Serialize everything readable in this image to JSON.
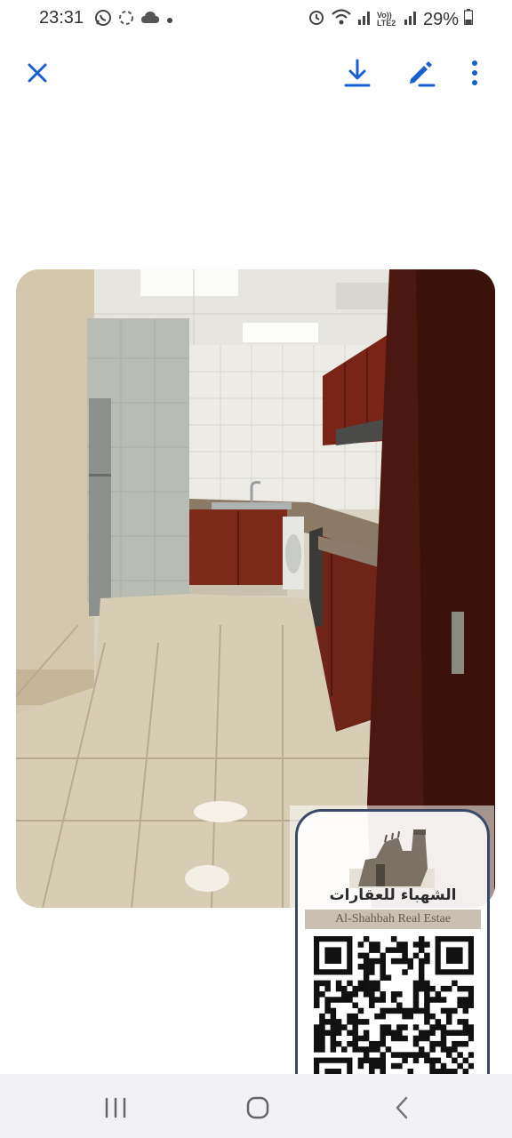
{
  "status_bar": {
    "time": "23:31",
    "battery": "29%",
    "network_label": "Vo)) LTE2",
    "icons_left": [
      "whatsapp-icon",
      "sync-icon",
      "cloud-icon",
      "dot-icon"
    ],
    "icons_right": [
      "alarm-icon",
      "wifi-icon",
      "signal-icon",
      "lte-icon",
      "signal-icon",
      "battery-icon"
    ]
  },
  "toolbar": {
    "icons": [
      "close-icon",
      "download-icon",
      "edit-icon",
      "more-vert-icon"
    ],
    "accent_color": "#1a5fd0"
  },
  "photo": {
    "subject": "kitchen interior"
  },
  "watermark": {
    "arabic_text": "الشهباء للعقارات",
    "english_text": "Al-Shahbah Real Estae"
  },
  "nav_bar": {
    "icons": [
      "recent-apps-icon",
      "home-icon",
      "back-icon"
    ]
  }
}
